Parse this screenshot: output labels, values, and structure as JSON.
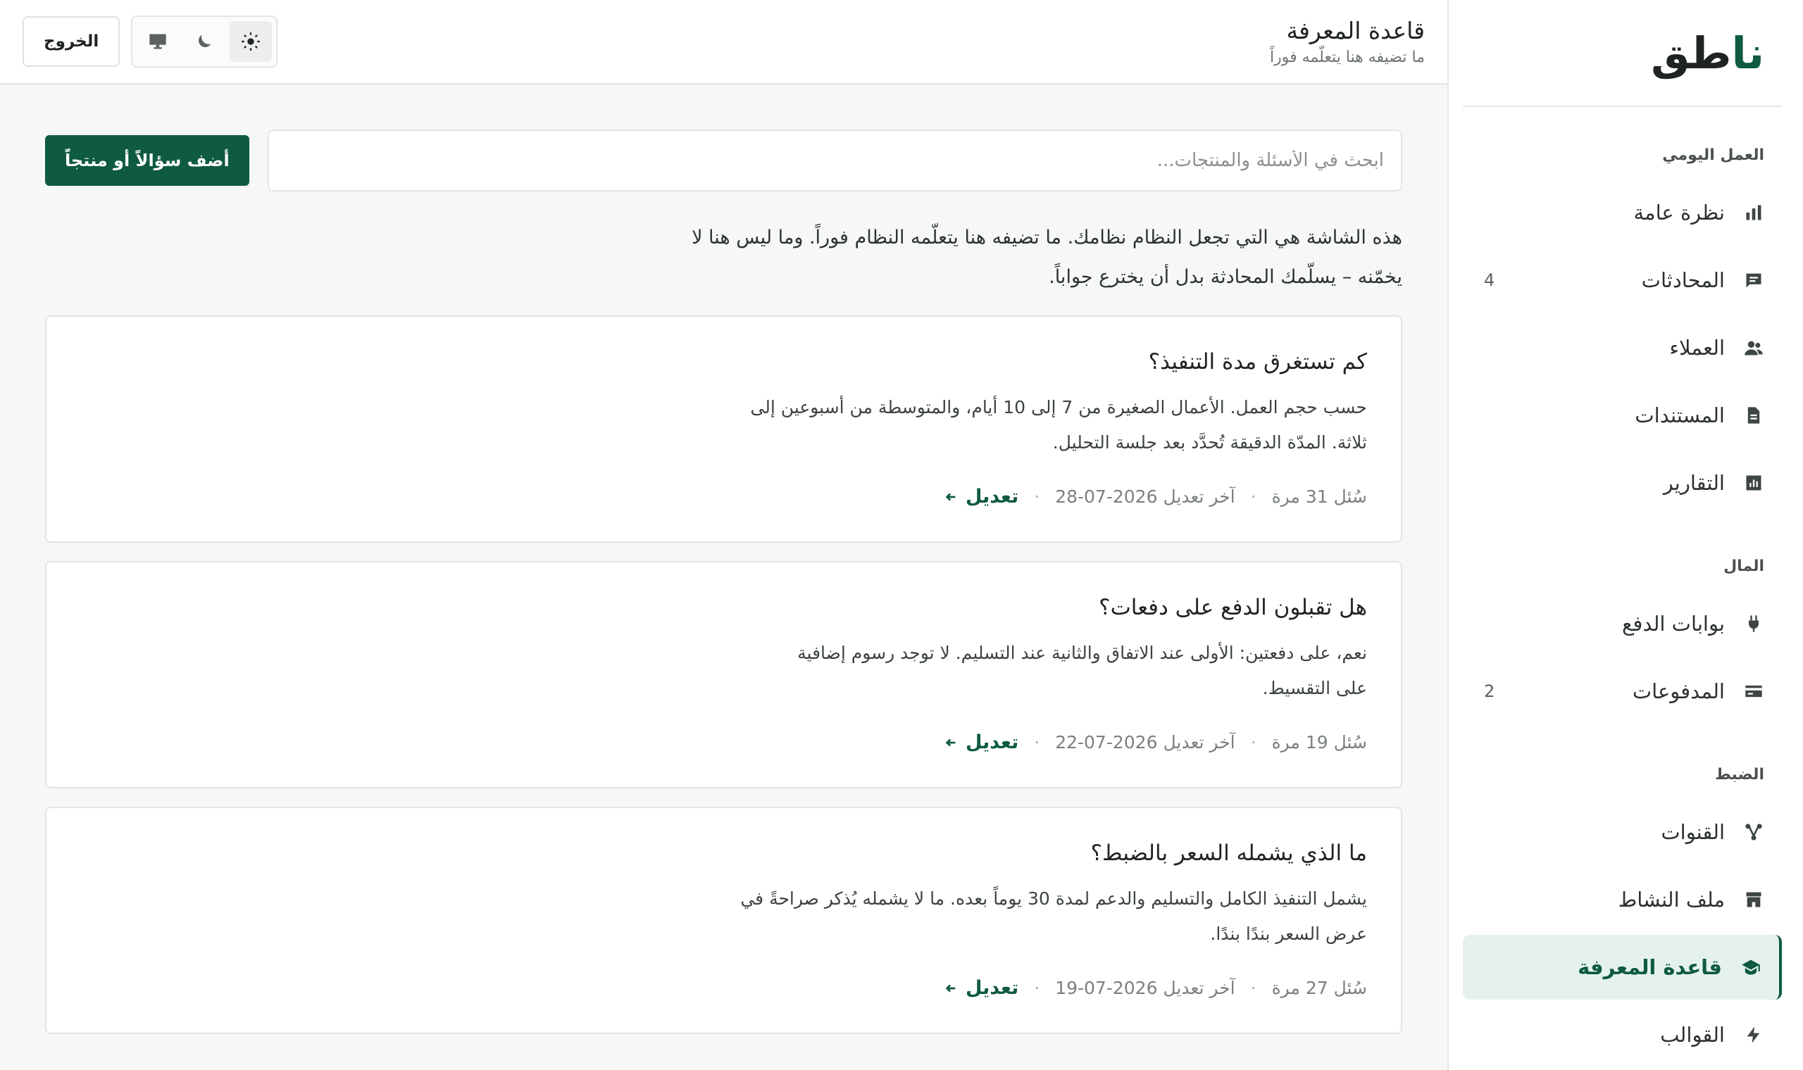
{
  "brand": {
    "name_main": "نا",
    "name_rest": "طق"
  },
  "sidebar": {
    "sections": [
      {
        "label": "العمل اليومي",
        "items": [
          {
            "label": "نظرة عامة",
            "icon": "bar-chart-icon",
            "count": ""
          },
          {
            "label": "المحادثات",
            "icon": "chat-icon",
            "count": "4"
          },
          {
            "label": "العملاء",
            "icon": "users-icon",
            "count": ""
          },
          {
            "label": "المستندات",
            "icon": "document-icon",
            "count": ""
          },
          {
            "label": "التقارير",
            "icon": "report-icon",
            "count": ""
          }
        ]
      },
      {
        "label": "المال",
        "items": [
          {
            "label": "بوابات الدفع",
            "icon": "plug-icon",
            "count": ""
          },
          {
            "label": "المدفوعات",
            "icon": "card-icon",
            "count": "2"
          }
        ]
      },
      {
        "label": "الضبط",
        "items": [
          {
            "label": "القنوات",
            "icon": "channels-icon",
            "count": ""
          },
          {
            "label": "ملف النشاط",
            "icon": "store-icon",
            "count": ""
          },
          {
            "label": "قاعدة المعرفة",
            "icon": "graduation-cap-icon",
            "count": "",
            "active": true
          },
          {
            "label": "القوالب",
            "icon": "bolt-icon",
            "count": ""
          }
        ]
      }
    ]
  },
  "header": {
    "title": "قاعدة المعرفة",
    "subtitle": "ما تضيفه هنا يتعلّمه فوراً",
    "logout_label": "الخروج",
    "theme_modes": [
      "light",
      "dark",
      "system"
    ],
    "theme_selected": "light"
  },
  "search": {
    "placeholder": "ابحث في الأسئلة والمنتجات...",
    "value": ""
  },
  "add_button_label": "أضف سؤالاً أو منتجاً",
  "intro_line1": "هذه الشاشة هي التي تجعل النظام نظامك. ما تضيفه هنا يتعلّمه النظام فوراً. وما ليس هنا لا",
  "intro_line2": "يخمّنه – يسلّمك المحادثة بدل أن يخترع جواباً.",
  "cards": [
    {
      "question": "كم تستغرق مدة التنفيذ؟",
      "answer_line1": "حسب حجم العمل. الأعمال الصغيرة من 7 إلى 10 أيام، والمتوسطة من أسبوعين إلى",
      "answer_line2": "ثلاثة. المدّة الدقيقة تُحدَّد بعد جلسة التحليل.",
      "asked": "سُئل 31 مرة",
      "last_edit": "آخر تعديل 2026-07-28",
      "edit_label": "تعديل"
    },
    {
      "question": "هل تقبلون الدفع على دفعات؟",
      "answer_line1": "نعم، على دفعتين: الأولى عند الاتفاق والثانية عند التسليم. لا توجد رسوم إضافية",
      "answer_line2": "على التقسيط.",
      "asked": "سُئل 19 مرة",
      "last_edit": "آخر تعديل 2026-07-22",
      "edit_label": "تعديل"
    },
    {
      "question": "ما الذي يشمله السعر بالضبط؟",
      "answer_line1": "يشمل التنفيذ الكامل والتسليم والدعم لمدة 30 يوماً بعده. ما لا يشمله يُذكر صراحةً في",
      "answer_line2": "عرض السعر بندًا بندًا.",
      "asked": "سُئل 27 مرة",
      "last_edit": "آخر تعديل 2026-07-19",
      "edit_label": "تعديل"
    }
  ],
  "colors": {
    "accent": "#0e5a43",
    "active_bg": "#e5f2ec"
  }
}
